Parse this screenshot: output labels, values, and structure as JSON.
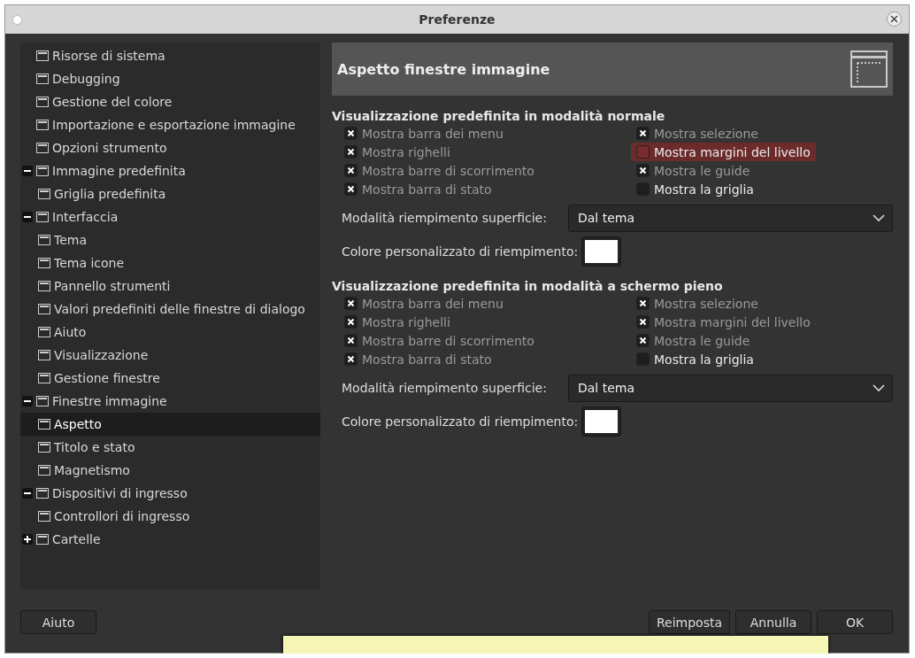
{
  "window": {
    "title": "Preferenze"
  },
  "tree": [
    {
      "label": "Risorse di sistema",
      "selected": false
    },
    {
      "label": "Debugging",
      "selected": false
    },
    {
      "label": "Gestione del colore",
      "selected": false
    },
    {
      "label": "Importazione e esportazione immagine",
      "selected": false
    },
    {
      "label": "Opzioni strumento",
      "selected": false
    },
    {
      "label": "Immagine predefinita",
      "selected": false,
      "expanded": true,
      "children": [
        {
          "label": "Griglia predefinita",
          "selected": false
        }
      ]
    },
    {
      "label": "Interfaccia",
      "selected": false,
      "expanded": true,
      "children": [
        {
          "label": "Tema",
          "selected": false
        },
        {
          "label": "Tema icone",
          "selected": false
        },
        {
          "label": "Pannello strumenti",
          "selected": false
        },
        {
          "label": "Valori predefiniti delle finestre di dialogo",
          "selected": false
        },
        {
          "label": "Aiuto",
          "selected": false
        },
        {
          "label": "Visualizzazione",
          "selected": false
        },
        {
          "label": "Gestione finestre",
          "selected": false
        }
      ]
    },
    {
      "label": "Finestre immagine",
      "selected": false,
      "expanded": true,
      "children": [
        {
          "label": "Aspetto",
          "selected": true
        },
        {
          "label": "Titolo e stato",
          "selected": false
        },
        {
          "label": "Magnetismo",
          "selected": false
        }
      ]
    },
    {
      "label": "Dispositivi di ingresso",
      "selected": false,
      "expanded": true,
      "children": [
        {
          "label": "Controllori di ingresso",
          "selected": false
        }
      ]
    },
    {
      "label": "Cartelle",
      "selected": false,
      "expanded": false
    }
  ],
  "page": {
    "title": "Aspetto finestre immagine"
  },
  "sections": [
    {
      "title": "Visualizzazione predefinita in modalità normale",
      "options": [
        {
          "label": "Mostra barra dei menu",
          "checked": true,
          "highlighted": false
        },
        {
          "label": "Mostra selezione",
          "checked": true,
          "highlighted": false
        },
        {
          "label": "Mostra righelli",
          "checked": true,
          "highlighted": false
        },
        {
          "label": "Mostra margini del livello",
          "checked": false,
          "highlighted": true
        },
        {
          "label": "Mostra barre di scorrimento",
          "checked": true,
          "highlighted": false
        },
        {
          "label": "Mostra le guide",
          "checked": true,
          "highlighted": false
        },
        {
          "label": "Mostra barra di stato",
          "checked": true,
          "highlighted": false
        },
        {
          "label": "Mostra la griglia",
          "checked": false,
          "highlighted": false
        }
      ],
      "fill_mode_label": "Modalità riempimento superficie:",
      "fill_mode_value": "Dal tema",
      "fill_color_label": "Colore personalizzato di riempimento:"
    },
    {
      "title": "Visualizzazione predefinita in modalità a schermo pieno",
      "options": [
        {
          "label": "Mostra barra dei menu",
          "checked": true,
          "highlighted": false
        },
        {
          "label": "Mostra selezione",
          "checked": true,
          "highlighted": false
        },
        {
          "label": "Mostra righelli",
          "checked": true,
          "highlighted": false
        },
        {
          "label": "Mostra margini del livello",
          "checked": true,
          "highlighted": false
        },
        {
          "label": "Mostra barre di scorrimento",
          "checked": true,
          "highlighted": false
        },
        {
          "label": "Mostra le guide",
          "checked": true,
          "highlighted": false
        },
        {
          "label": "Mostra barra di stato",
          "checked": true,
          "highlighted": false
        },
        {
          "label": "Mostra la griglia",
          "checked": false,
          "highlighted": false
        }
      ],
      "fill_mode_label": "Modalità riempimento superficie:",
      "fill_mode_value": "Dal tema",
      "fill_color_label": "Colore personalizzato di riempimento:"
    }
  ],
  "buttons_left": [
    "Aiuto"
  ],
  "buttons_right": [
    "Reimposta",
    "Annulla",
    "OK"
  ]
}
